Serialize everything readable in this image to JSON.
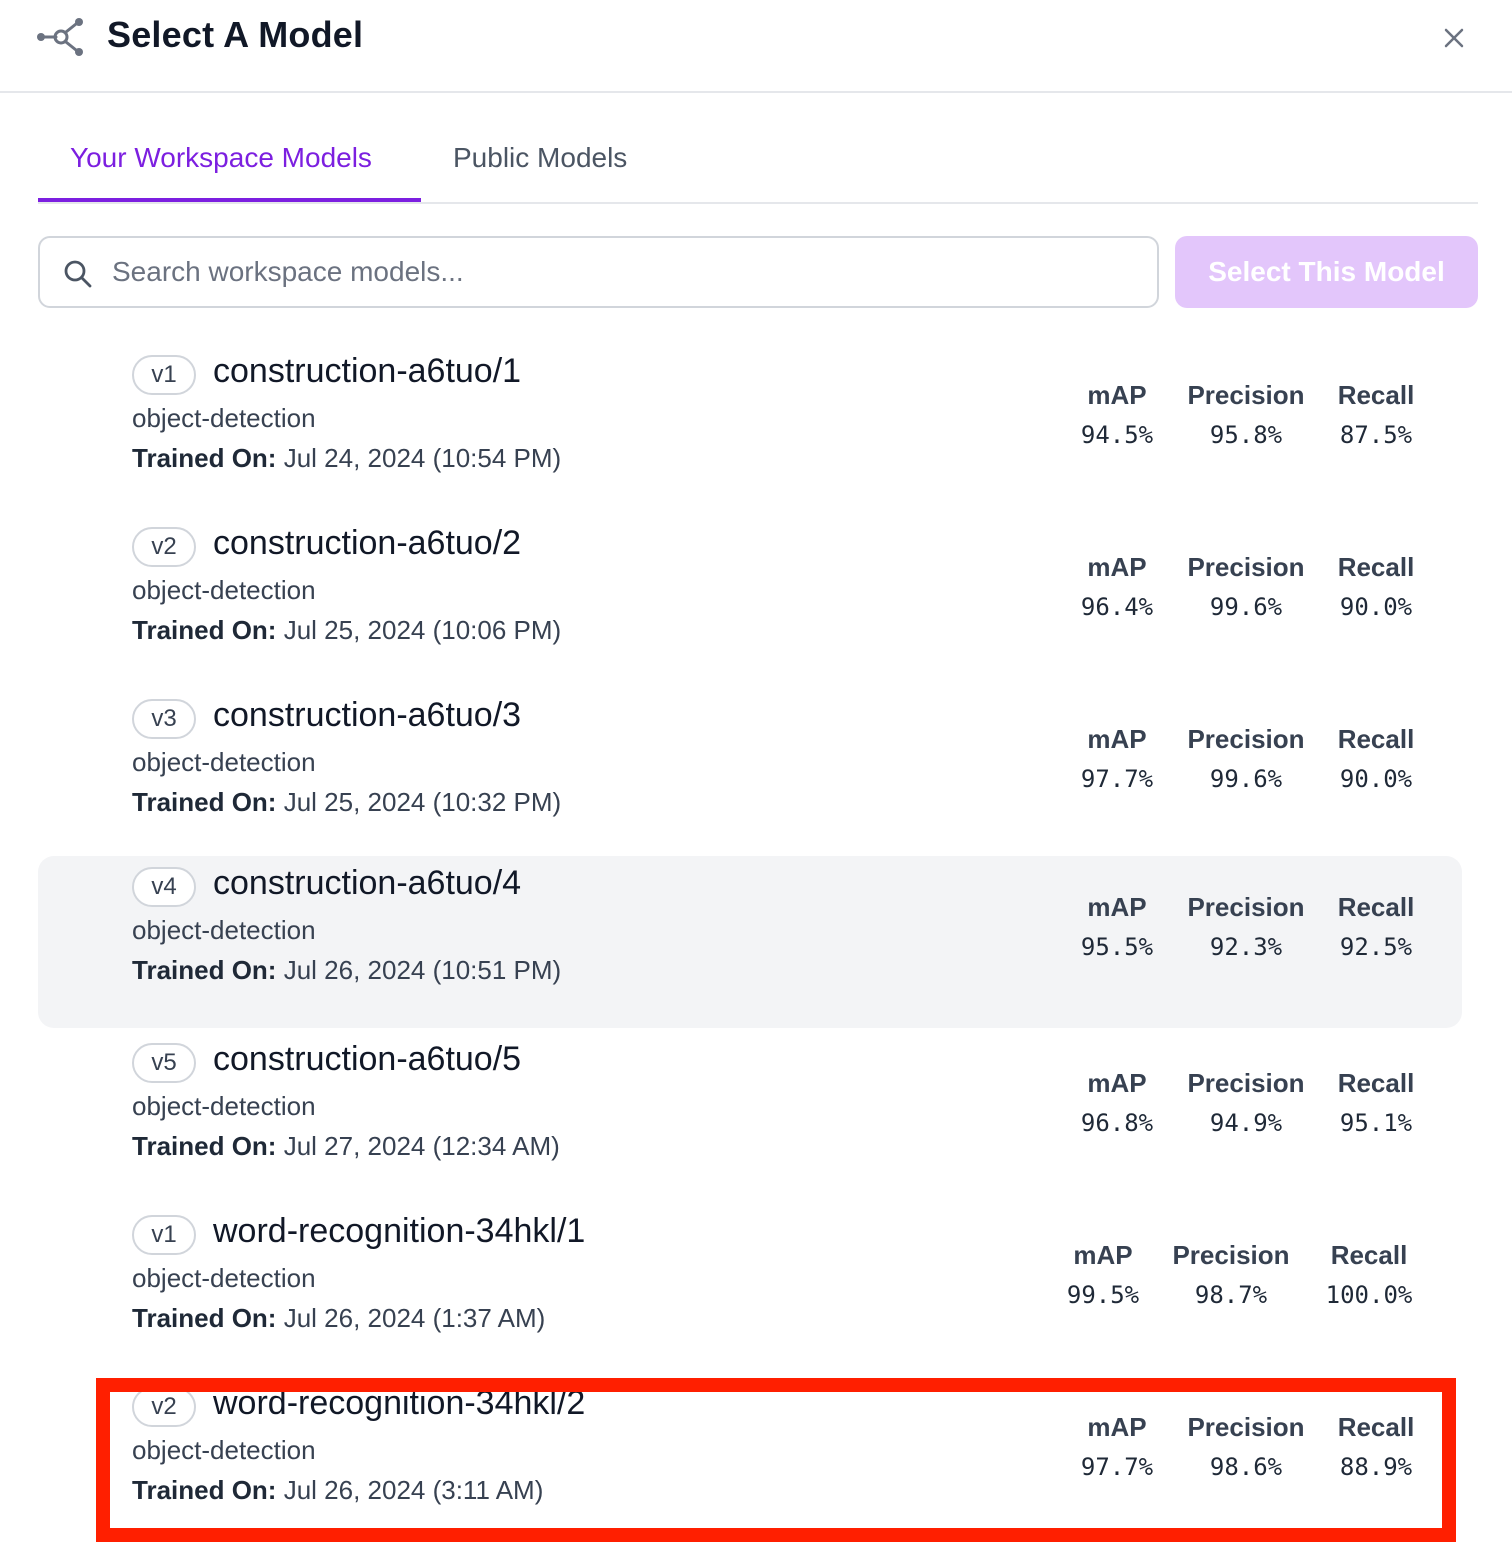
{
  "header": {
    "title": "Select A Model",
    "logo_icon": "network-nodes-icon",
    "close_icon": "close-icon"
  },
  "tabs": [
    {
      "label": "Your Workspace Models",
      "active": true
    },
    {
      "label": "Public Models",
      "active": false
    }
  ],
  "search": {
    "placeholder": "Search workspace models...",
    "value": "",
    "icon": "search-icon"
  },
  "select_button": {
    "label": "Select This Model",
    "enabled": false
  },
  "trained_label": "Trained On:",
  "metric_labels": {
    "map": "mAP",
    "precision": "Precision",
    "recall": "Recall"
  },
  "models": [
    {
      "version": "v1",
      "name": "construction-a6tuo/1",
      "type": "object-detection",
      "trained": "Jul 24, 2024 (10:54 PM)",
      "map": "94.5%",
      "precision": "95.8%",
      "recall": "87.5%"
    },
    {
      "version": "v2",
      "name": "construction-a6tuo/2",
      "type": "object-detection",
      "trained": "Jul 25, 2024 (10:06 PM)",
      "map": "96.4%",
      "precision": "99.6%",
      "recall": "90.0%"
    },
    {
      "version": "v3",
      "name": "construction-a6tuo/3",
      "type": "object-detection",
      "trained": "Jul 25, 2024 (10:32 PM)",
      "map": "97.7%",
      "precision": "99.6%",
      "recall": "90.0%"
    },
    {
      "version": "v4",
      "name": "construction-a6tuo/4",
      "type": "object-detection",
      "trained": "Jul 26, 2024 (10:51 PM)",
      "map": "95.5%",
      "precision": "92.3%",
      "recall": "92.5%",
      "hovered": true
    },
    {
      "version": "v5",
      "name": "construction-a6tuo/5",
      "type": "object-detection",
      "trained": "Jul 27, 2024 (12:34 AM)",
      "map": "96.8%",
      "precision": "94.9%",
      "recall": "95.1%"
    },
    {
      "version": "v1",
      "name": "word-recognition-34hkl/1",
      "type": "object-detection",
      "trained": "Jul 26, 2024 (1:37 AM)",
      "map": "99.5%",
      "precision": "98.7%",
      "recall": "100.0%"
    },
    {
      "version": "v2",
      "name": "word-recognition-34hkl/2",
      "type": "object-detection",
      "trained": "Jul 26, 2024 (3:11 AM)",
      "map": "97.7%",
      "precision": "98.6%",
      "recall": "88.9%",
      "highlighted": true
    }
  ],
  "colors": {
    "accent": "#7c1fe0",
    "button_disabled": "#e3c6fb",
    "hover_row": "#f3f4f6",
    "highlight_box": "#ff1f00"
  }
}
